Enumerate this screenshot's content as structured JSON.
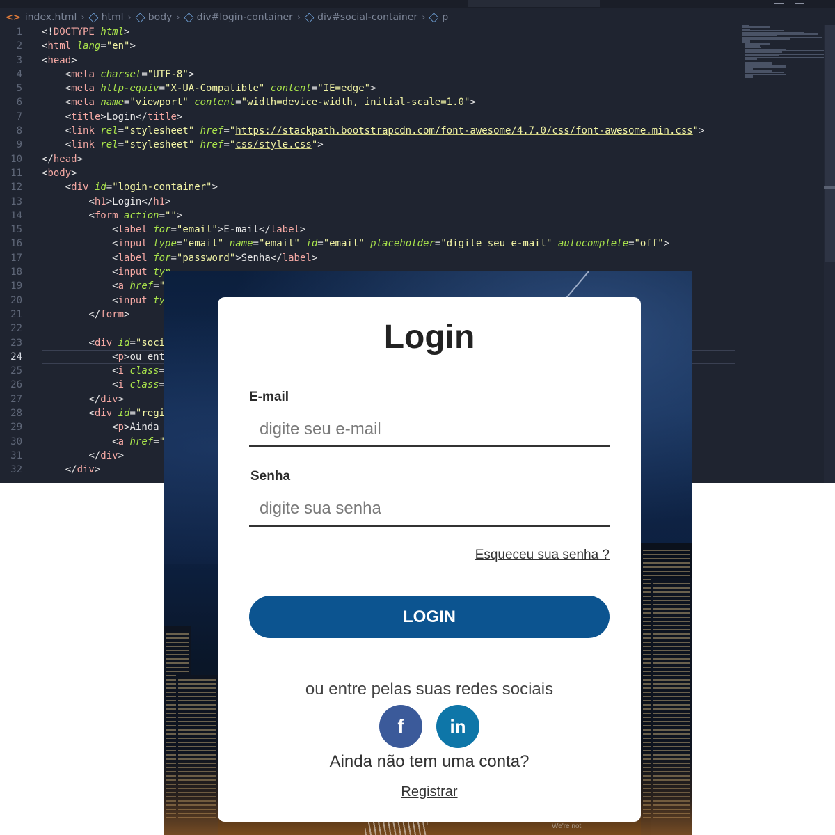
{
  "breadcrumb": [
    "index.html",
    "html",
    "body",
    "div#login-container",
    "div#social-container",
    "p"
  ],
  "code_lines": [
    {
      "n": "1",
      "t": [
        [
          "p",
          "<!"
        ],
        [
          "tag",
          "DOCTYPE"
        ],
        [
          "txt",
          " "
        ],
        [
          "attr",
          "html"
        ],
        [
          "p",
          ">"
        ]
      ]
    },
    {
      "n": "2",
      "t": [
        [
          "p",
          "<"
        ],
        [
          "tag",
          "html"
        ],
        [
          "txt",
          " "
        ],
        [
          "attr",
          "lang"
        ],
        [
          "p",
          "="
        ],
        [
          "str",
          "\"en\""
        ],
        [
          "p",
          ">"
        ]
      ]
    },
    {
      "n": "3",
      "t": [
        [
          "p",
          "<"
        ],
        [
          "tag",
          "head"
        ],
        [
          "p",
          ">"
        ]
      ]
    },
    {
      "n": "4",
      "t": [
        [
          "txt",
          "    "
        ],
        [
          "p",
          "<"
        ],
        [
          "tag",
          "meta"
        ],
        [
          "txt",
          " "
        ],
        [
          "attr",
          "charset"
        ],
        [
          "p",
          "="
        ],
        [
          "str",
          "\"UTF-8\""
        ],
        [
          "p",
          ">"
        ]
      ]
    },
    {
      "n": "5",
      "t": [
        [
          "txt",
          "    "
        ],
        [
          "p",
          "<"
        ],
        [
          "tag",
          "meta"
        ],
        [
          "txt",
          " "
        ],
        [
          "attr",
          "http-equiv"
        ],
        [
          "p",
          "="
        ],
        [
          "str",
          "\"X-UA-Compatible\""
        ],
        [
          "txt",
          " "
        ],
        [
          "attr",
          "content"
        ],
        [
          "p",
          "="
        ],
        [
          "str",
          "\"IE=edge\""
        ],
        [
          "p",
          ">"
        ]
      ]
    },
    {
      "n": "6",
      "t": [
        [
          "txt",
          "    "
        ],
        [
          "p",
          "<"
        ],
        [
          "tag",
          "meta"
        ],
        [
          "txt",
          " "
        ],
        [
          "attr",
          "name"
        ],
        [
          "p",
          "="
        ],
        [
          "str",
          "\"viewport\""
        ],
        [
          "txt",
          " "
        ],
        [
          "attr",
          "content"
        ],
        [
          "p",
          "="
        ],
        [
          "str",
          "\"width=device-width, initial-scale=1.0\""
        ],
        [
          "p",
          ">"
        ]
      ]
    },
    {
      "n": "7",
      "t": [
        [
          "txt",
          "    "
        ],
        [
          "p",
          "<"
        ],
        [
          "tag",
          "title"
        ],
        [
          "p",
          ">"
        ],
        [
          "txt",
          "Login"
        ],
        [
          "p",
          "</"
        ],
        [
          "tag",
          "title"
        ],
        [
          "p",
          ">"
        ]
      ]
    },
    {
      "n": "8",
      "t": [
        [
          "txt",
          "    "
        ],
        [
          "p",
          "<"
        ],
        [
          "tag",
          "link"
        ],
        [
          "txt",
          " "
        ],
        [
          "attr",
          "rel"
        ],
        [
          "p",
          "="
        ],
        [
          "str",
          "\"stylesheet\""
        ],
        [
          "txt",
          " "
        ],
        [
          "attr",
          "href"
        ],
        [
          "p",
          "="
        ],
        [
          "str",
          "\""
        ],
        [
          "url",
          "https://stackpath.bootstrapcdn.com/font-awesome/4.7.0/css/font-awesome.min.css"
        ],
        [
          "str",
          "\""
        ],
        [
          "p",
          ">"
        ]
      ]
    },
    {
      "n": "9",
      "t": [
        [
          "txt",
          "    "
        ],
        [
          "p",
          "<"
        ],
        [
          "tag",
          "link"
        ],
        [
          "txt",
          " "
        ],
        [
          "attr",
          "rel"
        ],
        [
          "p",
          "="
        ],
        [
          "str",
          "\"stylesheet\""
        ],
        [
          "txt",
          " "
        ],
        [
          "attr",
          "href"
        ],
        [
          "p",
          "="
        ],
        [
          "str",
          "\""
        ],
        [
          "url",
          "css/style.css"
        ],
        [
          "str",
          "\""
        ],
        [
          "p",
          ">"
        ]
      ]
    },
    {
      "n": "10",
      "t": [
        [
          "p",
          "</"
        ],
        [
          "tag",
          "head"
        ],
        [
          "p",
          ">"
        ]
      ]
    },
    {
      "n": "11",
      "t": [
        [
          "p",
          "<"
        ],
        [
          "tag",
          "body"
        ],
        [
          "p",
          ">"
        ]
      ]
    },
    {
      "n": "12",
      "t": [
        [
          "txt",
          "    "
        ],
        [
          "p",
          "<"
        ],
        [
          "tag",
          "div"
        ],
        [
          "txt",
          " "
        ],
        [
          "attr",
          "id"
        ],
        [
          "p",
          "="
        ],
        [
          "str",
          "\"login-container\""
        ],
        [
          "p",
          ">"
        ]
      ]
    },
    {
      "n": "13",
      "t": [
        [
          "txt",
          "        "
        ],
        [
          "p",
          "<"
        ],
        [
          "tag",
          "h1"
        ],
        [
          "p",
          ">"
        ],
        [
          "txt",
          "Login"
        ],
        [
          "p",
          "</"
        ],
        [
          "tag",
          "h1"
        ],
        [
          "p",
          ">"
        ]
      ]
    },
    {
      "n": "14",
      "t": [
        [
          "txt",
          "        "
        ],
        [
          "p",
          "<"
        ],
        [
          "tag",
          "form"
        ],
        [
          "txt",
          " "
        ],
        [
          "attr",
          "action"
        ],
        [
          "p",
          "="
        ],
        [
          "str",
          "\"\""
        ],
        [
          "p",
          ">"
        ]
      ]
    },
    {
      "n": "15",
      "t": [
        [
          "txt",
          "            "
        ],
        [
          "p",
          "<"
        ],
        [
          "tag",
          "label"
        ],
        [
          "txt",
          " "
        ],
        [
          "attr",
          "for"
        ],
        [
          "p",
          "="
        ],
        [
          "str",
          "\"email\""
        ],
        [
          "p",
          ">"
        ],
        [
          "txt",
          "E-mail"
        ],
        [
          "p",
          "</"
        ],
        [
          "tag",
          "label"
        ],
        [
          "p",
          ">"
        ]
      ]
    },
    {
      "n": "16",
      "t": [
        [
          "txt",
          "            "
        ],
        [
          "p",
          "<"
        ],
        [
          "tag",
          "input"
        ],
        [
          "txt",
          " "
        ],
        [
          "attr",
          "type"
        ],
        [
          "p",
          "="
        ],
        [
          "str",
          "\"email\""
        ],
        [
          "txt",
          " "
        ],
        [
          "attr",
          "name"
        ],
        [
          "p",
          "="
        ],
        [
          "str",
          "\"email\""
        ],
        [
          "txt",
          " "
        ],
        [
          "attr",
          "id"
        ],
        [
          "p",
          "="
        ],
        [
          "str",
          "\"email\""
        ],
        [
          "txt",
          " "
        ],
        [
          "attr",
          "placeholder"
        ],
        [
          "p",
          "="
        ],
        [
          "str",
          "\"digite seu e-mail\""
        ],
        [
          "txt",
          " "
        ],
        [
          "attr",
          "autocomplete"
        ],
        [
          "p",
          "="
        ],
        [
          "str",
          "\"off\""
        ],
        [
          "p",
          ">"
        ]
      ]
    },
    {
      "n": "17",
      "t": [
        [
          "txt",
          "            "
        ],
        [
          "p",
          "<"
        ],
        [
          "tag",
          "label"
        ],
        [
          "txt",
          " "
        ],
        [
          "attr",
          "for"
        ],
        [
          "p",
          "="
        ],
        [
          "str",
          "\"password\""
        ],
        [
          "p",
          ">"
        ],
        [
          "txt",
          "Senha"
        ],
        [
          "p",
          "</"
        ],
        [
          "tag",
          "label"
        ],
        [
          "p",
          ">"
        ]
      ]
    },
    {
      "n": "18",
      "t": [
        [
          "txt",
          "            "
        ],
        [
          "p",
          "<"
        ],
        [
          "tag",
          "input"
        ],
        [
          "txt",
          " "
        ],
        [
          "attr",
          "typ"
        ]
      ]
    },
    {
      "n": "19",
      "t": [
        [
          "txt",
          "            "
        ],
        [
          "p",
          "<"
        ],
        [
          "tag",
          "a"
        ],
        [
          "txt",
          " "
        ],
        [
          "attr",
          "href"
        ],
        [
          "p",
          "="
        ],
        [
          "str",
          "\""
        ]
      ]
    },
    {
      "n": "20",
      "t": [
        [
          "txt",
          "            "
        ],
        [
          "p",
          "<"
        ],
        [
          "tag",
          "input"
        ],
        [
          "txt",
          " "
        ],
        [
          "attr",
          "typ"
        ]
      ]
    },
    {
      "n": "21",
      "t": [
        [
          "txt",
          "        "
        ],
        [
          "p",
          "</"
        ],
        [
          "tag",
          "form"
        ],
        [
          "p",
          ">"
        ]
      ]
    },
    {
      "n": "22",
      "t": []
    },
    {
      "n": "23",
      "t": [
        [
          "txt",
          "        "
        ],
        [
          "p",
          "<"
        ],
        [
          "tag",
          "div"
        ],
        [
          "txt",
          " "
        ],
        [
          "attr",
          "id"
        ],
        [
          "p",
          "="
        ],
        [
          "str",
          "\"soci"
        ]
      ]
    },
    {
      "n": "24",
      "t": [
        [
          "txt",
          "            "
        ],
        [
          "p",
          "<"
        ],
        [
          "tag",
          "p"
        ],
        [
          "p",
          ">"
        ],
        [
          "txt",
          "ou entr"
        ]
      ]
    },
    {
      "n": "25",
      "t": [
        [
          "txt",
          "            "
        ],
        [
          "p",
          "<"
        ],
        [
          "tag",
          "i"
        ],
        [
          "txt",
          " "
        ],
        [
          "attr",
          "class"
        ],
        [
          "p",
          "="
        ],
        [
          "str",
          "'"
        ]
      ]
    },
    {
      "n": "26",
      "t": [
        [
          "txt",
          "            "
        ],
        [
          "p",
          "<"
        ],
        [
          "tag",
          "i"
        ],
        [
          "txt",
          " "
        ],
        [
          "attr",
          "class"
        ],
        [
          "p",
          "="
        ],
        [
          "str",
          "'"
        ]
      ]
    },
    {
      "n": "27",
      "t": [
        [
          "txt",
          "        "
        ],
        [
          "p",
          "</"
        ],
        [
          "tag",
          "div"
        ],
        [
          "p",
          ">"
        ]
      ]
    },
    {
      "n": "28",
      "t": [
        [
          "txt",
          "        "
        ],
        [
          "p",
          "<"
        ],
        [
          "tag",
          "div"
        ],
        [
          "txt",
          " "
        ],
        [
          "attr",
          "id"
        ],
        [
          "p",
          "="
        ],
        [
          "str",
          "\"regi"
        ]
      ]
    },
    {
      "n": "29",
      "t": [
        [
          "txt",
          "            "
        ],
        [
          "p",
          "<"
        ],
        [
          "tag",
          "p"
        ],
        [
          "p",
          ">"
        ],
        [
          "txt",
          "Ainda r"
        ]
      ]
    },
    {
      "n": "30",
      "t": [
        [
          "txt",
          "            "
        ],
        [
          "p",
          "<"
        ],
        [
          "tag",
          "a"
        ],
        [
          "txt",
          " "
        ],
        [
          "attr",
          "href"
        ],
        [
          "p",
          "="
        ],
        [
          "str",
          "\"i"
        ]
      ]
    },
    {
      "n": "31",
      "t": [
        [
          "txt",
          "        "
        ],
        [
          "p",
          "</"
        ],
        [
          "tag",
          "div"
        ],
        [
          "p",
          ">"
        ]
      ]
    },
    {
      "n": "32",
      "t": [
        [
          "txt",
          "    "
        ],
        [
          "p",
          "</"
        ],
        [
          "tag",
          "div"
        ],
        [
          "p",
          ">"
        ]
      ]
    }
  ],
  "active_line": "24",
  "login": {
    "title": "Login",
    "email_label": "E-mail",
    "email_placeholder": "digite seu e-mail",
    "password_label": "Senha",
    "password_placeholder": "digite sua senha",
    "forgot_link": "Esqueceu sua senha ?",
    "login_button": "LOGIN",
    "social_text": "ou entre pelas suas redes sociais",
    "facebook_glyph": "f",
    "linkedin_glyph": "in",
    "register_text": "Ainda não tem uma conta?",
    "register_link": "Registrar"
  },
  "background_caption": "We're not",
  "colors": {
    "editor_bg": "#1f2430",
    "tag": "#f4a8a3",
    "attribute": "#a9e34b",
    "string": "#f1f3a4",
    "login_button": "#0c5490",
    "facebook": "#3b5a9a",
    "linkedin": "#0e76a8"
  },
  "icons": [
    "html-file-icon",
    "element-cube-icon",
    "facebook-icon",
    "linkedin-icon"
  ]
}
